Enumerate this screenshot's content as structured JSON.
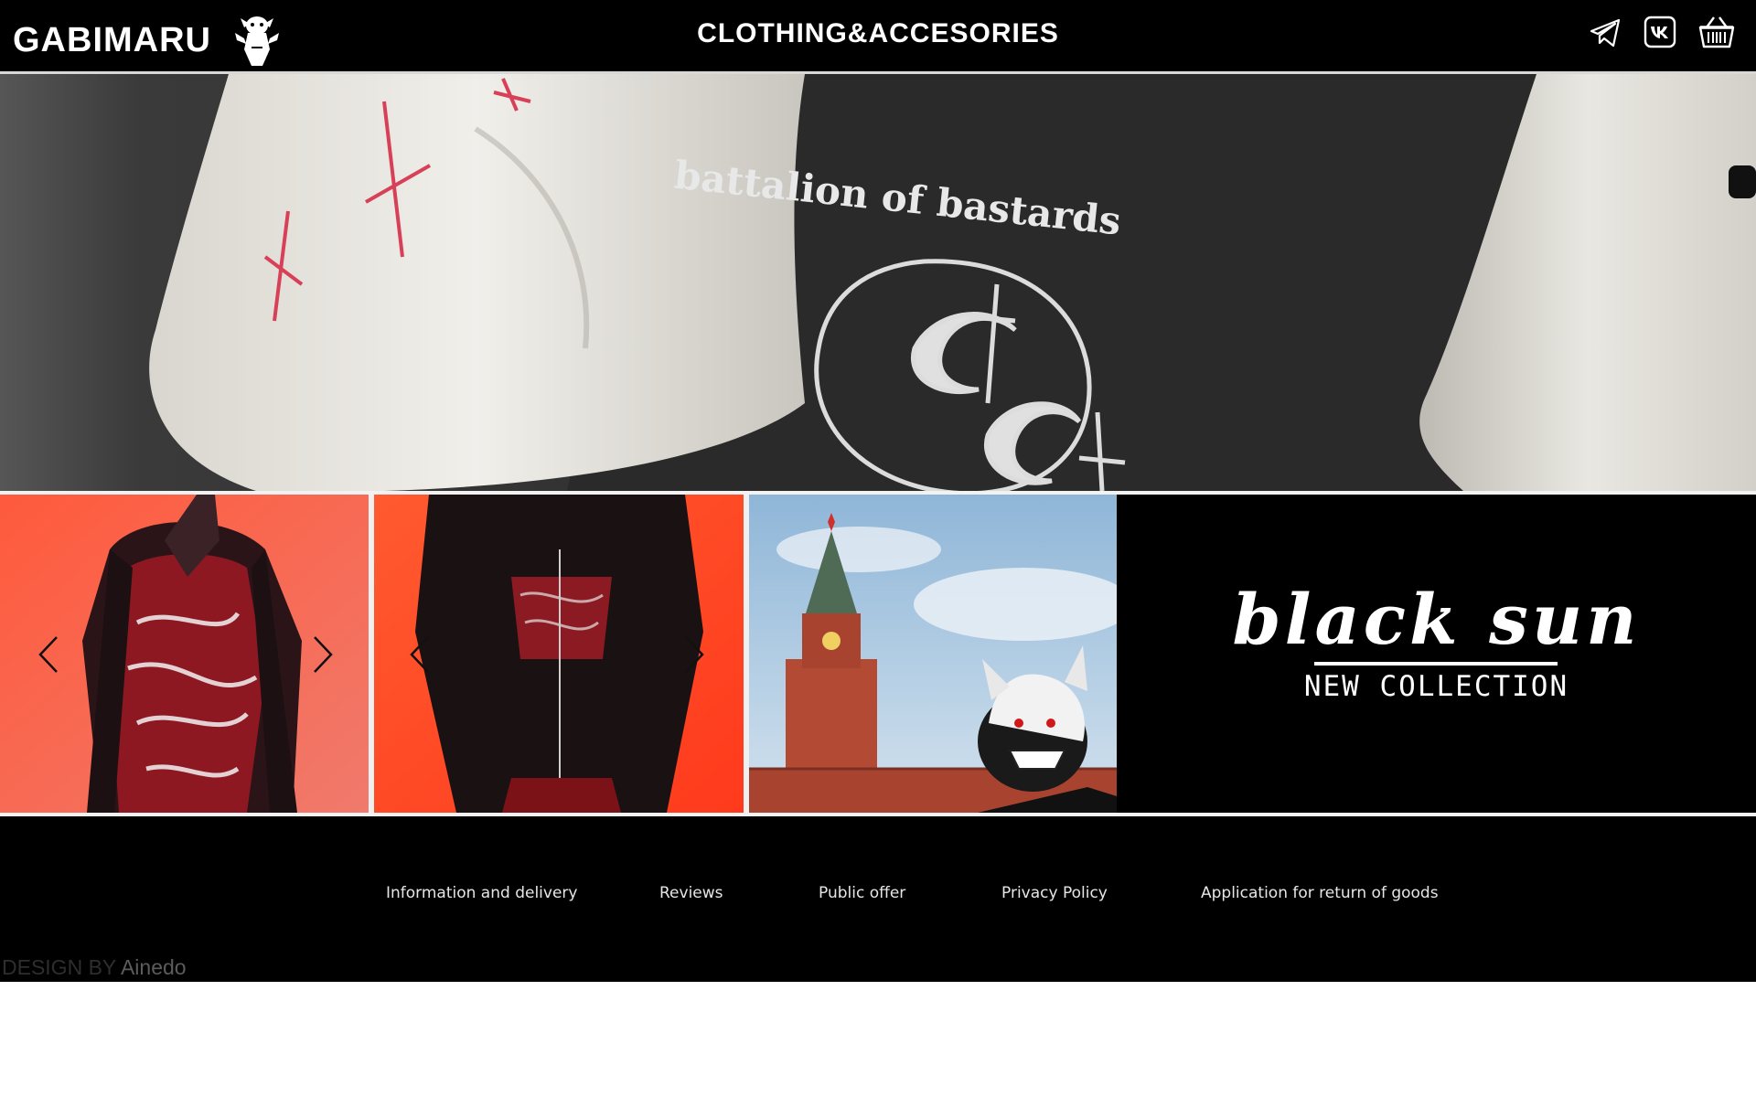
{
  "header": {
    "brand": "GABIMARU",
    "title": "CLOTHING&ACCESORIES",
    "icons": [
      "telegram-icon",
      "vk-icon",
      "basket-icon"
    ]
  },
  "hero": {
    "print_text": "battalion of bastards"
  },
  "promo": {
    "title": "black sun",
    "subtitle": "NEW COLLECTION"
  },
  "footer": {
    "links": [
      "Information and delivery",
      "Reviews",
      "Public offer",
      "Privacy Policy",
      "Application for return of goods"
    ],
    "credit_prefix": "DESIGN BY",
    "credit_name": "Ainedo"
  },
  "colors": {
    "background": "#000000",
    "text": "#ffffff",
    "tile_red": "#ff4a2e",
    "sky": "#a9cbe3",
    "kremlin_red": "#b24a34"
  }
}
